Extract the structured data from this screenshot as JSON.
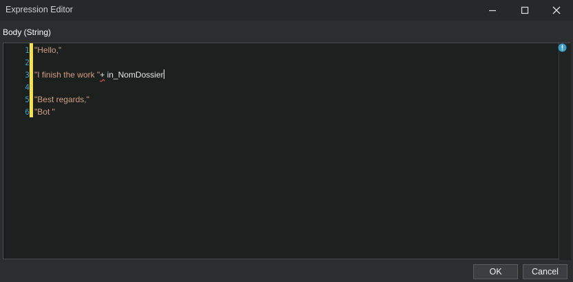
{
  "window": {
    "title": "Expression Editor"
  },
  "field": {
    "label": "Body (String)"
  },
  "editor": {
    "lines": [
      {
        "number": "1",
        "segments": [
          {
            "text": "\"Hello,\"",
            "kind": "str"
          }
        ]
      },
      {
        "number": "2",
        "segments": []
      },
      {
        "number": "3",
        "segments": [
          {
            "text": "\"I finish the work \"",
            "kind": "str"
          },
          {
            "text": "+",
            "kind": "squiggle"
          },
          {
            "text": " in_NomDossier",
            "kind": "id"
          }
        ],
        "caret": true
      },
      {
        "number": "4",
        "segments": []
      },
      {
        "number": "5",
        "segments": [
          {
            "text": "\"Best regards,\"",
            "kind": "str"
          }
        ]
      },
      {
        "number": "6",
        "segments": [
          {
            "text": "\"Bot \"",
            "kind": "str"
          }
        ]
      }
    ]
  },
  "buttons": {
    "ok_label": "OK",
    "cancel_label": "Cancel"
  },
  "colors": {
    "string": "#d69d85",
    "line_number": "#3b9cc6",
    "change_bar": "#f5e051",
    "info_icon": "#3b9cc6"
  },
  "icons": {
    "minimize": "minimize-icon",
    "maximize": "maximize-icon",
    "close": "close-icon",
    "info": "info-icon"
  }
}
